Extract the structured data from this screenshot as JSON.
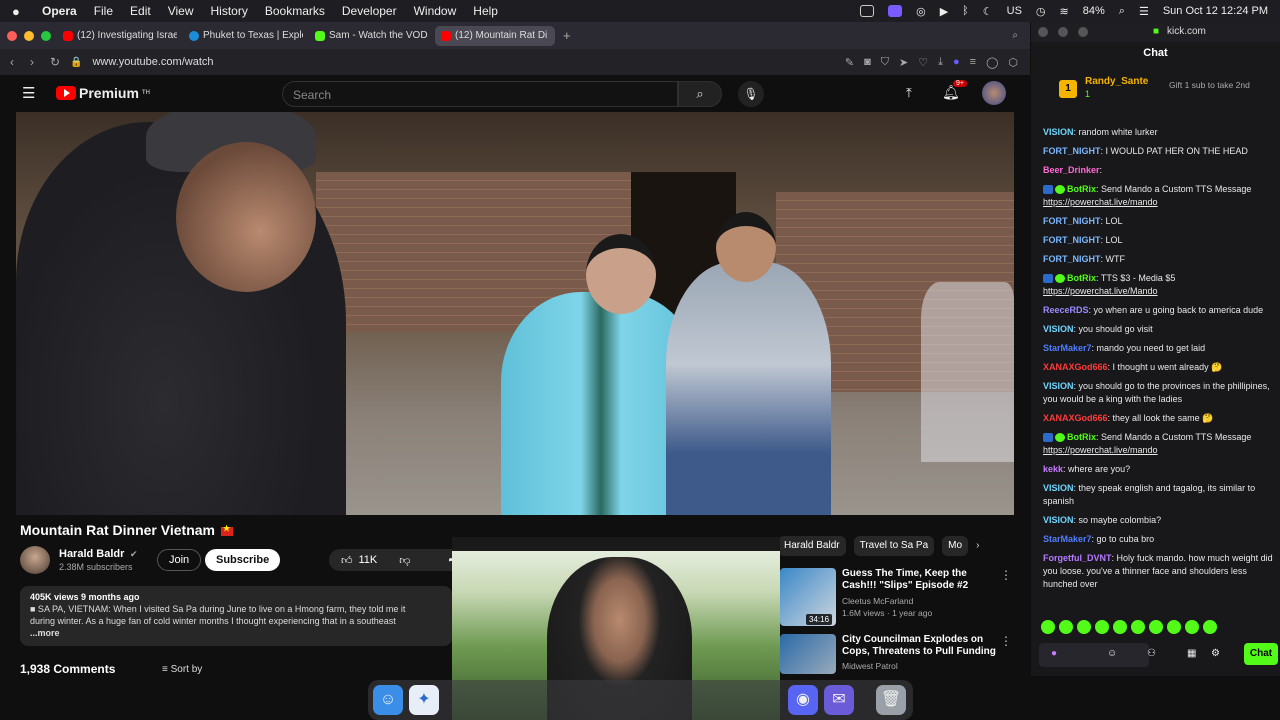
{
  "menubar": {
    "app": "Opera",
    "items": [
      "File",
      "Edit",
      "View",
      "History",
      "Bookmarks",
      "Developer",
      "Window",
      "Help"
    ],
    "battery": "84%",
    "clock": "Sun Oct 12  12:24 PM"
  },
  "tabs": [
    {
      "label": "(12) Investigating Israeli",
      "color": "#ff0000"
    },
    {
      "label": "Phuket to Texas | Explor",
      "color": "#1a8cd8"
    },
    {
      "label": "Sam - Watch the VOD o",
      "color": "#53fc18"
    },
    {
      "label": "(12) Mountain Rat Di",
      "color": "#ff0000",
      "active": true
    }
  ],
  "address": {
    "url": "www.youtube.com/watch"
  },
  "youtube": {
    "logo": "Premium",
    "logo_sup": "TH",
    "search_placeholder": "Search",
    "notif_count": "9+",
    "video_title": "Mountain Rat Dinner Vietnam",
    "channel_name": "Harald Baldr",
    "channel_subs": "2.38M subscribers",
    "join_label": "Join",
    "subscribe_label": "Subscribe",
    "likes": "11K",
    "share_label": "Share",
    "desc_meta": "405K views  9 months ago",
    "desc_line1": "■ SA PA, VIETNAM: When I visited Sa Pa during June to live on a Hmong farm, they told me it",
    "desc_line2": "during winter. As a huge fan of cold winter months I thought experiencing that in a southeast",
    "desc_more": "...more",
    "comments": "1,938 Comments",
    "sort_label": "Sort by",
    "chips": [
      "Harald Baldr",
      "Travel to Sa Pa",
      "Mo"
    ],
    "recs": [
      {
        "title": "Guess The Time, Keep the Cash!!! \"Slips\" Episode #2",
        "channel": "Cleetus McFarland",
        "meta": "1.6M views · 1 year ago",
        "duration": "34:16"
      },
      {
        "title": "City Councilman Explodes on Cops, Threatens to Pull Funding",
        "channel": "Midwest Patrol",
        "meta": "",
        "duration": ""
      }
    ]
  },
  "chat": {
    "site": "kick.com",
    "title": "Chat",
    "gifter": {
      "name": "Randy_Sante",
      "sub": "1",
      "msg": "Gift 1 sub to take 2nd",
      "rank": "1"
    },
    "messages": [
      {
        "user": "VISION",
        "color": "#6fd6ff",
        "text": "random white lurker"
      },
      {
        "user": "FORT_NIGHT",
        "color": "#7ab8ff",
        "text": "I WOULD PAT HER ON THE HEAD"
      },
      {
        "user": "Beer_Drinker",
        "color": "#ff6ad5",
        "text": ""
      },
      {
        "user": "BotRix",
        "color": "#53fc18",
        "text": "Send Mando a Custom TTS Message ",
        "link": "https://powerchat.live/mando",
        "badges": true
      },
      {
        "user": "FORT_NIGHT",
        "color": "#7ab8ff",
        "text": "LOL"
      },
      {
        "user": "FORT_NIGHT",
        "color": "#7ab8ff",
        "text": "LOL"
      },
      {
        "user": "FORT_NIGHT",
        "color": "#7ab8ff",
        "text": "WTF"
      },
      {
        "user": "BotRix",
        "color": "#53fc18",
        "text": "TTS $3 - Media $5 ",
        "link": "https://powerchat.live/Mando",
        "badges": true
      },
      {
        "user": "ReeceRDS",
        "color": "#9b8cff",
        "text": "yo when are u going back to america dude"
      },
      {
        "user": "VISION",
        "color": "#6fd6ff",
        "text": "you should go visit"
      },
      {
        "user": "StarMaker7",
        "color": "#4f7dff",
        "text": "mando you need to get laid"
      },
      {
        "user": "XANAXGod666",
        "color": "#ff3b3b",
        "text": "I thought u went already 🤔"
      },
      {
        "user": "VISION",
        "color": "#6fd6ff",
        "text": "you should go to the provinces in the phillipines, you would be a king with the ladies"
      },
      {
        "user": "XANAXGod666",
        "color": "#ff3b3b",
        "text": "they all look the same 🤔"
      },
      {
        "user": "BotRix",
        "color": "#53fc18",
        "text": "Send Mando a Custom TTS Message ",
        "link": "https://powerchat.live/mando",
        "badges": true
      },
      {
        "user": "kekk",
        "color": "#c87bff",
        "text": "where are you?"
      },
      {
        "user": "VISION",
        "color": "#6fd6ff",
        "text": "they speak english and tagalog, its similar to spanish"
      },
      {
        "user": "VISION",
        "color": "#6fd6ff",
        "text": "so maybe colombia?"
      },
      {
        "user": "StarMaker7",
        "color": "#4f7dff",
        "text": "go to cuba bro"
      },
      {
        "user": "Forgetful_DVNT",
        "color": "#b57bff",
        "text": "Holy fuck mando. how much weight did you loose. you've a thinner face and shoulders less hunched over"
      }
    ],
    "send_label": "Chat"
  }
}
